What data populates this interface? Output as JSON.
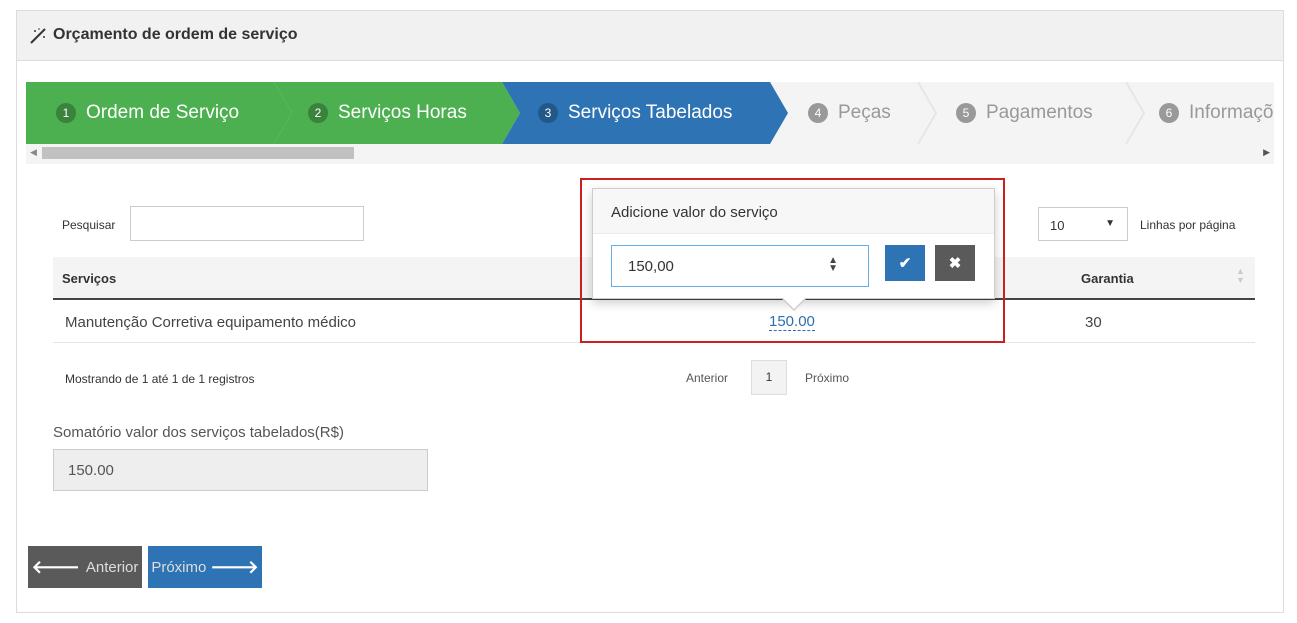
{
  "header": {
    "title": "Orçamento de ordem de serviço",
    "icon": "magic-wand-icon"
  },
  "wizard": {
    "steps": [
      {
        "num": "1",
        "label": "Ordem de Serviço",
        "state": "done"
      },
      {
        "num": "2",
        "label": "Serviços Horas",
        "state": "done"
      },
      {
        "num": "3",
        "label": "Serviços Tabelados",
        "state": "active"
      },
      {
        "num": "4",
        "label": "Peças",
        "state": "todo"
      },
      {
        "num": "5",
        "label": "Pagamentos",
        "state": "todo"
      },
      {
        "num": "6",
        "label": "Informaçõ",
        "state": "todo"
      }
    ],
    "colors": {
      "done": "#4caf50",
      "active": "#2e74b5",
      "todo": "#f4f4f4"
    }
  },
  "table_controls": {
    "search_label": "Pesquisar",
    "search_value": "",
    "page_size": "10",
    "rows_label": "Linhas por página"
  },
  "table": {
    "headers": {
      "servicos": "Serviços",
      "garantia": "Garantia"
    },
    "rows": [
      {
        "servico": "Manutenção Corretiva equipamento médico",
        "valor": "150.00",
        "garantia": "30"
      }
    ]
  },
  "pagination": {
    "info": "Mostrando de 1 até 1 de 1 registros",
    "prev": "Anterior",
    "page": "1",
    "next": "Próximo"
  },
  "summary": {
    "label": "Somatório valor dos serviços tabelados(R$)",
    "value": "150.00"
  },
  "nav": {
    "prev_label": "Anterior",
    "next_label": "Próximo"
  },
  "popover": {
    "title": "Adicione valor do serviço",
    "input_value": "150,00",
    "ok_icon": "check-icon",
    "cancel_icon": "close-icon"
  }
}
